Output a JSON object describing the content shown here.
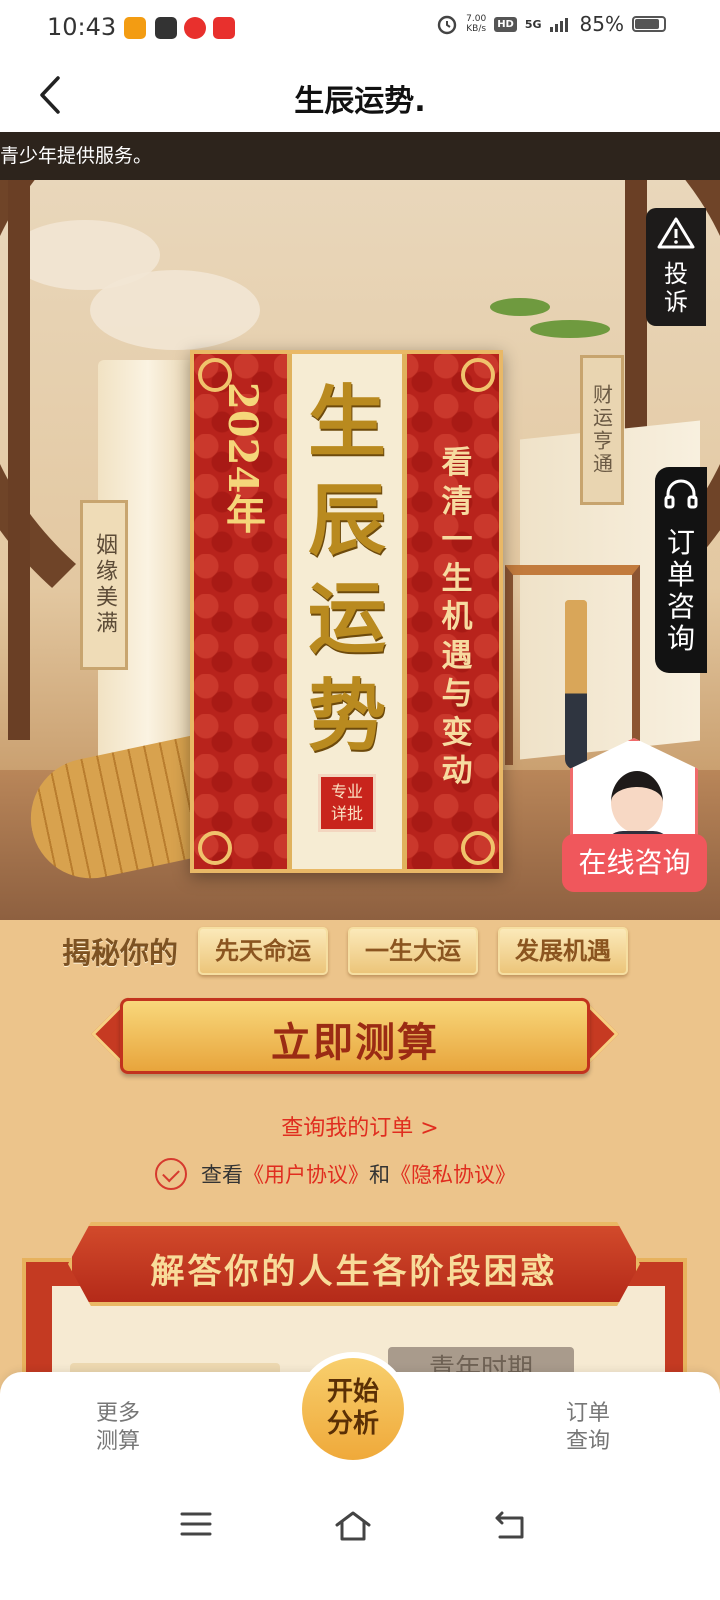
{
  "status_bar": {
    "time": "10:43",
    "net_speed_value": "7.00",
    "net_speed_unit": "KB/s",
    "hd_label": "HD",
    "network_label": "5G",
    "battery_percent": "85%",
    "battery_level": 0.85,
    "notification_icon_colors": [
      "#f39c12",
      "#333333",
      "#e8302d",
      "#e8302d"
    ]
  },
  "header": {
    "back_icon": "chevron-left-icon",
    "title": "生辰运势."
  },
  "notice": {
    "text": "青少年提供服务。"
  },
  "hero": {
    "year": "2024年",
    "main_title": [
      "生",
      "辰",
      "运",
      "势"
    ],
    "seal_text": [
      "专业",
      "详批"
    ],
    "tagline": [
      "看",
      "清",
      "一",
      "生",
      "机",
      "遇",
      "与",
      "变",
      "动"
    ],
    "left_scroll_label": "姻缘美满",
    "right_scroll_label": "财运亨通"
  },
  "floating": {
    "complain_label": [
      "投",
      "诉"
    ],
    "complain_icon": "warning-triangle-icon",
    "order_consult_label": [
      "订",
      "单",
      "咨",
      "询"
    ],
    "order_consult_icon": "headset-icon",
    "online_consult_label": "在线咨询"
  },
  "reveal": {
    "label": "揭秘你的",
    "tags": [
      "先天命运",
      "一生大运",
      "发展机遇"
    ]
  },
  "cta": {
    "start_label": "立即测算",
    "order_link": "查询我的订单 >",
    "agree_prefix": "查看",
    "user_agreement": "《用户协议》",
    "agree_and": "和",
    "privacy_agreement": "《隐私协议》"
  },
  "answer_section": {
    "title": "解答你的人生各阶段困惑",
    "partial_tab": "青年时期"
  },
  "bottom_nav": {
    "more": [
      "更多",
      "测算"
    ],
    "start": [
      "开始",
      "分析"
    ],
    "orders": [
      "订单",
      "查询"
    ]
  },
  "colors": {
    "accent_red": "#e02d1f",
    "poster_red": "#b8231c",
    "gold": "#e9b866",
    "consult_pink": "#f0575c"
  }
}
